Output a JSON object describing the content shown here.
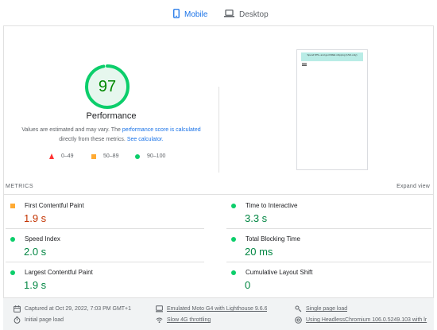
{
  "tabs": [
    {
      "label": "Mobile",
      "icon": "smartphone-icon",
      "active": true
    },
    {
      "label": "Desktop",
      "icon": "laptop-icon",
      "active": false
    }
  ],
  "performance": {
    "score": "97",
    "score_fraction": 0.97,
    "title": "Performance",
    "note_prefix": "Values are estimated and may vary. The ",
    "note_link1": "performance score is calculated",
    "note_middle": " directly from these metrics. ",
    "note_link2": "See calculator.",
    "colors": {
      "pass": "#0cce6b",
      "average": "#ffaa33",
      "fail": "#ff3333"
    }
  },
  "legend": [
    {
      "range": "0–49",
      "shape": "triangle"
    },
    {
      "range": "50–89",
      "shape": "square"
    },
    {
      "range": "90–100",
      "shape": "circle"
    }
  ],
  "thumbnail": {
    "banner_text": "Spend $75+ and get FREE shipping (USA only)"
  },
  "metrics": {
    "label": "METRICS",
    "expand": "Expand view",
    "items": [
      {
        "name": "First Contentful Paint",
        "value": "1.9 s",
        "status": "average"
      },
      {
        "name": "Time to Interactive",
        "value": "3.3 s",
        "status": "pass"
      },
      {
        "name": "Speed Index",
        "value": "2.0 s",
        "status": "pass"
      },
      {
        "name": "Total Blocking Time",
        "value": "20 ms",
        "status": "pass"
      },
      {
        "name": "Largest Contentful Paint",
        "value": "1.9 s",
        "status": "pass"
      },
      {
        "name": "Cumulative Layout Shift",
        "value": "0",
        "status": "pass"
      }
    ]
  },
  "footer": [
    {
      "icon": "calendar-icon",
      "text": "Captured at Oct 29, 2022, 7:03 PM GMT+1",
      "link": false
    },
    {
      "icon": "device-icon",
      "text": "Emulated Moto G4 with Lighthouse 9.6.6",
      "link": true
    },
    {
      "icon": "single-page-icon",
      "text": "Single page load",
      "link": true
    },
    {
      "icon": "timer-icon",
      "text": "Initial page load",
      "link": false
    },
    {
      "icon": "wifi-icon",
      "text": "Slow 4G throttling",
      "link": true
    },
    {
      "icon": "chrome-icon",
      "text": "Using HeadlessChromium 106.0.5249.103 with lr",
      "link": true
    }
  ]
}
